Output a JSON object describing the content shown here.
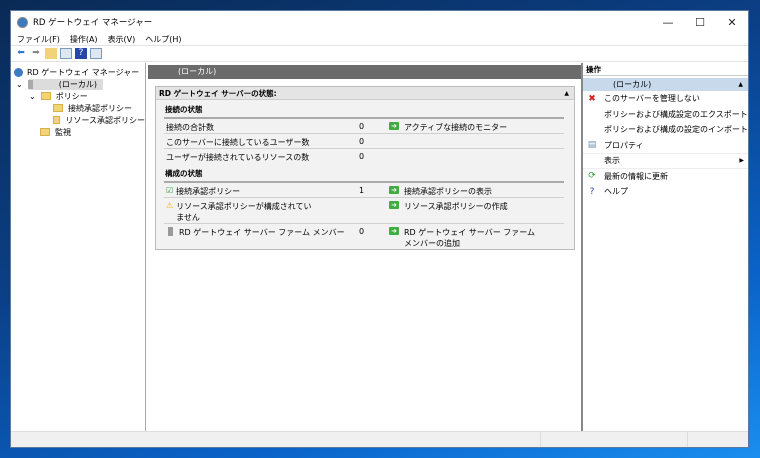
{
  "window": {
    "title": "RD ゲートウェイ マネージャー",
    "minimize": "—",
    "maximize": "☐",
    "close": "✕"
  },
  "menu": [
    "ファイル(F)",
    "操作(A)",
    "表示(V)",
    "ヘルプ(H)"
  ],
  "tree": {
    "root": "RD ゲートウェイ マネージャー",
    "server": "(ローカル)",
    "policies": "ポリシー",
    "cap": "接続承認ポリシー",
    "rap": "リソース承認ポリシー",
    "monitor": "監視"
  },
  "middle": {
    "header": "(ローカル)",
    "panel_title": "RD ゲートウェイ サーバーの状態:",
    "conn_section": "接続の状態",
    "conn_rows": [
      {
        "label": "接続の合計数",
        "value": "0",
        "action": "アクティブな接続のモニター"
      },
      {
        "label": "このサーバーに接続しているユーザー数",
        "value": "0",
        "action": ""
      },
      {
        "label": "ユーザーが接続されているリソースの数",
        "value": "0",
        "action": ""
      }
    ],
    "config_section": "構成の状態",
    "config_rows": [
      {
        "label": "接続承認ポリシー",
        "value": "1",
        "action": "接続承認ポリシーの表示",
        "icon": "policy-check-icon"
      },
      {
        "label": "リソース承認ポリシーが構成されていません",
        "value": "",
        "action": "リソース承認ポリシーの作成",
        "icon": "warning-icon"
      },
      {
        "label": "RD ゲートウェイ サーバー ファーム メンバー",
        "value": "0",
        "action": "RD ゲートウェイ サーバー ファーム メンバーの追加",
        "icon": "server-icon"
      }
    ]
  },
  "actions": {
    "header": "操作",
    "sub": "(ローカル)",
    "items": [
      {
        "label": "このサーバーを管理しない",
        "icon": "✖",
        "color": "#d42020"
      },
      {
        "label": "ポリシーおよび構成設定のエクスポート",
        "icon": ""
      },
      {
        "label": "ポリシーおよび構成の設定のインポート",
        "icon": ""
      },
      {
        "label": "プロパティ",
        "icon": "▤",
        "color": "#6a8fb0"
      },
      {
        "label": "表示",
        "icon": "",
        "submenu": "▶"
      },
      {
        "label": "最新の情報に更新",
        "icon": "⟳",
        "color": "#2e9a3a"
      },
      {
        "label": "ヘルプ",
        "icon": "?",
        "color": "#2646a8"
      }
    ]
  }
}
